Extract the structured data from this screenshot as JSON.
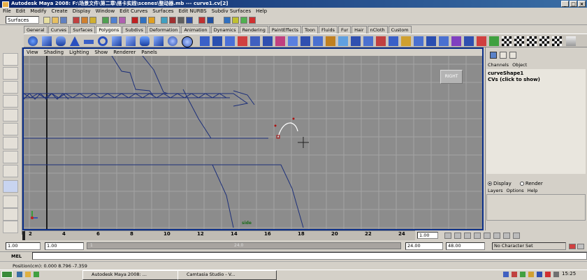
{
  "window": {
    "title": "Autodesk Maya 2008: F:\\场景文件\\第二章\\搭卡实践\\scenes\\整动器.mb   ---   curve1.cv[2]",
    "buttons": [
      "_",
      "□",
      "×"
    ]
  },
  "menubar": [
    "File",
    "Edit",
    "Modify",
    "Create",
    "Display",
    "Window",
    "Edit Curves",
    "Surfaces",
    "Edit NURBS",
    "Subdiv Surfaces",
    "Help"
  ],
  "statusline": {
    "mode": "Surfaces"
  },
  "shelf": {
    "tabs": [
      "General",
      "Curves",
      "Surfaces",
      "Polygons",
      "Subdivs",
      "Deformation",
      "Animation",
      "Dynamics",
      "Rendering",
      "PaintEffects",
      "Toon",
      "Fluids",
      "Fur",
      "Hair",
      "nCloth",
      "Custom"
    ],
    "active_tab": "Polygons"
  },
  "viewport": {
    "panel_menu": [
      "View",
      "Shading",
      "Lighting",
      "Show",
      "Renderer",
      "Panels"
    ],
    "view_cube_label": "RIGHT",
    "camera_label": "side"
  },
  "channel_box": {
    "tabs": [
      "Channels",
      "Object"
    ],
    "node": "curveShape1",
    "cvs": "CVs (click to show)",
    "display_options": [
      "Display",
      "Render"
    ],
    "display_selected": "Display",
    "layer_menu": [
      "Layers",
      "Options",
      "Help"
    ]
  },
  "timeslider": {
    "ticks": [
      "2",
      "4",
      "6",
      "8",
      "10",
      "12",
      "14",
      "16",
      "18",
      "20",
      "22",
      "24"
    ],
    "current_frame": "1.00"
  },
  "range": {
    "start": "1.00",
    "playback_start": "1.00",
    "bar_left": "1",
    "bar_right": "24.0",
    "playback_end": "24.00",
    "end": "48.00",
    "character_set": "No Character Set"
  },
  "mel": {
    "label": "MEL"
  },
  "helpline": {
    "text": "Position(cm): 0.000    8.796    -7.359"
  },
  "taskbar": {
    "items": [
      "Autodesk Maya 2008: ...",
      "Camtasia Studio - V..."
    ],
    "clock": "15:25"
  },
  "colors": {
    "titlebar": "#0a246a",
    "viewport_bg": "#8c8c8c",
    "curve": "#1c2f7a",
    "selected": "#ffffff"
  }
}
